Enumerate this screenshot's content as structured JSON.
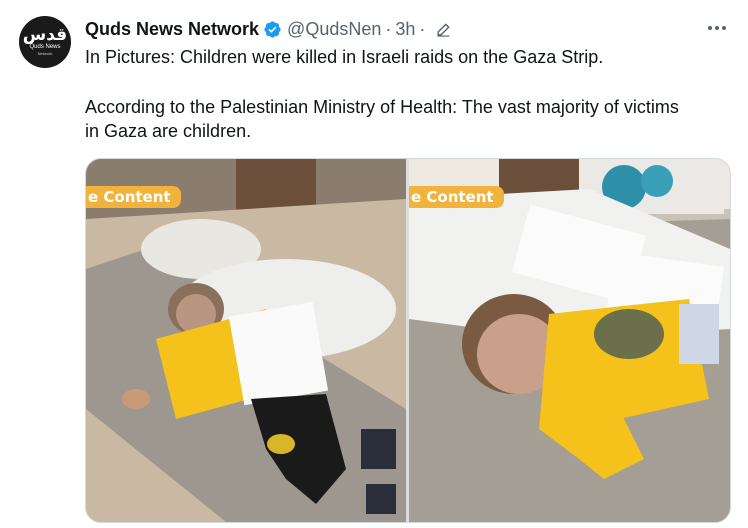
{
  "tweet": {
    "avatar": {
      "logo_text": "قدس",
      "logo_subtitle": "Quds News",
      "logo_subtitle_small": "Network"
    },
    "display_name": "Quds News Network",
    "handle": "@QudsNen",
    "separator": "·",
    "time": "3h",
    "text_line1": "In Pictures: Children were killed in Israeli raids on the Gaza Strip.",
    "text_line2": "According to the Palestinian Ministry of Health: The vast majority of victims",
    "text_line3": "in Gaza are children.",
    "media": [
      {
        "badge": "e Content"
      },
      {
        "badge": "e Content"
      }
    ]
  },
  "colors": {
    "verified": "#1d9bf0",
    "secondary_text": "#536471",
    "badge_background": "#f2b33d",
    "shirt_yellow": "#f4c21a"
  },
  "icons": [
    "verified-badge-icon",
    "edit-icon",
    "more-options-icon"
  ]
}
